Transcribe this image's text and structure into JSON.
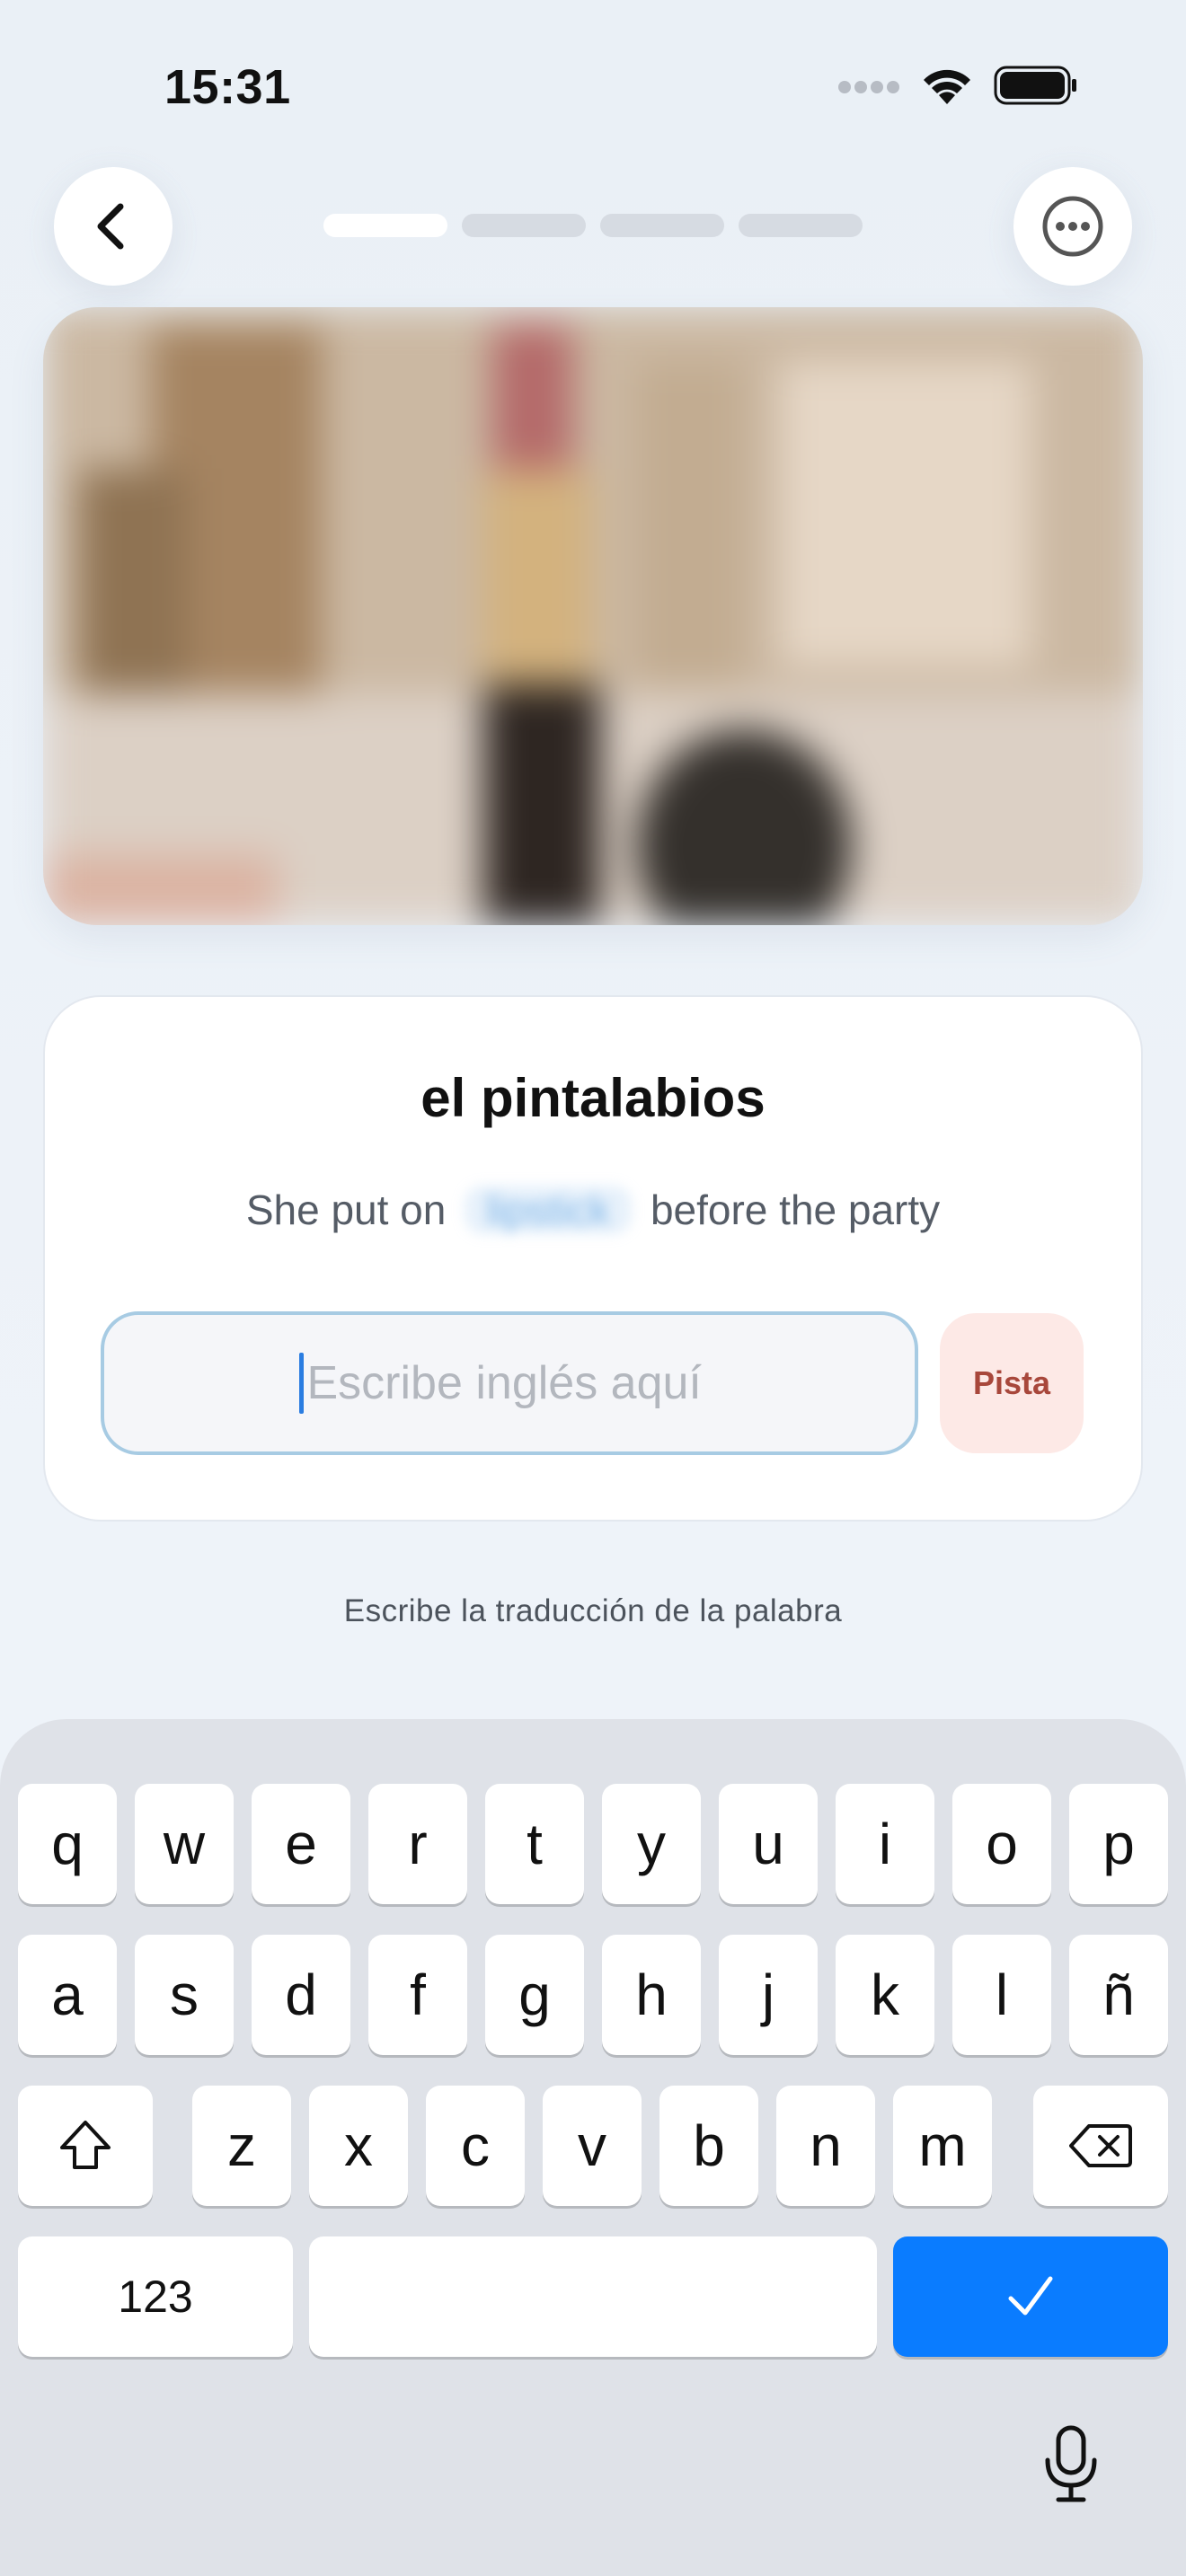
{
  "status_bar": {
    "time": "15:31"
  },
  "progress": {
    "total": 4,
    "current": 1
  },
  "icons": {
    "back": "chevron-left-icon",
    "more": "ellipsis-circle-icon",
    "shift": "shift-icon",
    "delete": "backspace-icon",
    "done": "checkmark-icon",
    "mic": "microphone-icon"
  },
  "card": {
    "word": "el pintalabios",
    "sentence_before": "She put on",
    "sentence_hidden": "lipstick",
    "sentence_after": "before the party",
    "input_value": "",
    "input_placeholder": "Escribe inglés aquí",
    "hint_label": "Pista"
  },
  "instruction": "Escribe la traducción de la palabra",
  "keyboard": {
    "row1": [
      "q",
      "w",
      "e",
      "r",
      "t",
      "y",
      "u",
      "i",
      "o",
      "p"
    ],
    "row2": [
      "a",
      "s",
      "d",
      "f",
      "g",
      "h",
      "j",
      "k",
      "l",
      "ñ"
    ],
    "row3": [
      "z",
      "x",
      "c",
      "v",
      "b",
      "n",
      "m"
    ],
    "numbers_label": "123"
  },
  "colors": {
    "accent": "#0a7cff",
    "hint_bg": "#fde9e6",
    "hint_text": "#a8473b",
    "input_border": "#a7cbe3"
  }
}
